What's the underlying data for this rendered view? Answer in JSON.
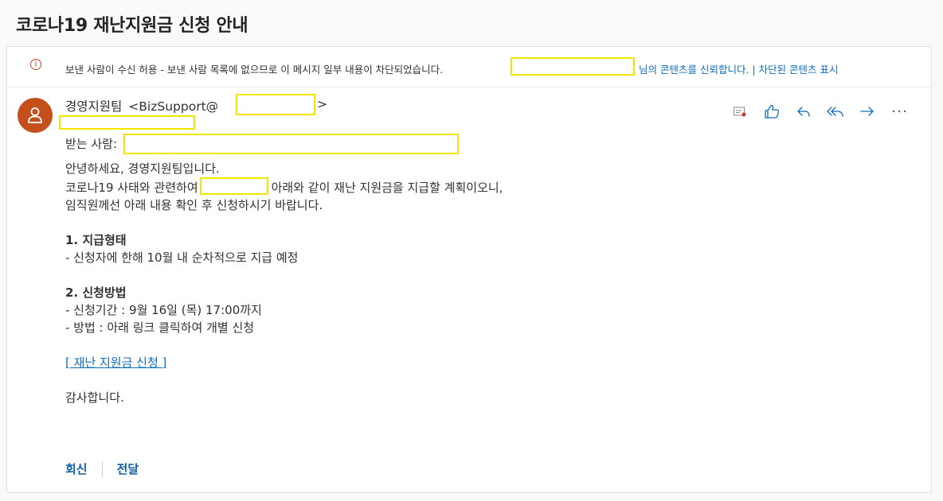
{
  "subject": "코로나19 재난지원금 신청 안내",
  "banner": {
    "icon": "info-icon",
    "message": "보낸 사람이 수신 허용 - 보낸 사람 목록에 없으므로 이 메시지 일부 내용이 차단되었습니다.",
    "trust_link": "님의 콘텐츠를 신뢰합니다. | 차단된 콘텐츠 표시"
  },
  "sender": {
    "name": "경영지원팀",
    "email_prefix": "<BizSupport@",
    "email_suffix": ">"
  },
  "to_label": "받는 사람:",
  "actions": [
    "sensitivity-icon",
    "like-icon",
    "reply-icon",
    "reply-all-icon",
    "forward-icon",
    "more-icon"
  ],
  "body": {
    "line1": "안녕하세요, 경영지원팀입니다.",
    "line2a": "코로나19 사태와 관련하여",
    "line2b": "아래와 같이 재난 지원금을 지급할 계획이오니,",
    "line3": "임직원께선 아래 내용 확인 후 신청하시기 바랍니다.",
    "s1_title": "1. 지급형태",
    "s1_item": "- 신청자에 한해 10월 내 순차적으로 지급 예정",
    "s2_title": "2. 신청방법",
    "s2_item1": "- 신청기간 : 9월 16일 (목) 17:00까지",
    "s2_item2": "- 방법 : 아래 링크 클릭하여 개별 신청",
    "link": "[ 재난 지원금 신청 ]",
    "closing": "감사합니다."
  },
  "footer": {
    "reply": "회신",
    "forward": "전달"
  },
  "colors": {
    "accent": "#0f6cbd",
    "avatar": "#c54f1b",
    "redaction": "#f2e600",
    "warning": "#c14a2a"
  }
}
